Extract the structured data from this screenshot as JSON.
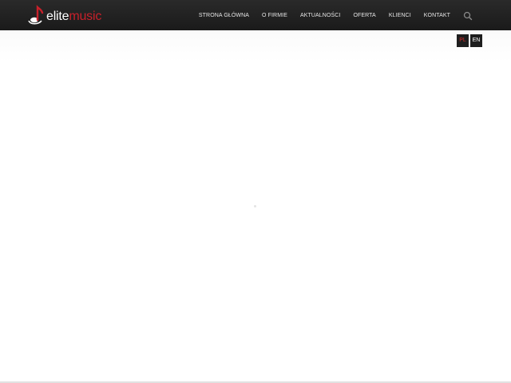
{
  "brand": {
    "elite": "elite",
    "music": "music",
    "accent_color": "#c8202a",
    "icon": "music-note-logo-icon"
  },
  "nav": {
    "items": [
      {
        "label": "STRONA GŁÓWNA"
      },
      {
        "label": "O FIRMIE"
      },
      {
        "label": "AKTUALNOŚCI"
      },
      {
        "label": "OFERTA"
      },
      {
        "label": "KLIENCI"
      },
      {
        "label": "KONTAKT"
      }
    ],
    "search_icon": "search-icon"
  },
  "languages": {
    "items": [
      {
        "label": "PL",
        "active": true
      },
      {
        "label": "EN",
        "active": false
      }
    ]
  }
}
